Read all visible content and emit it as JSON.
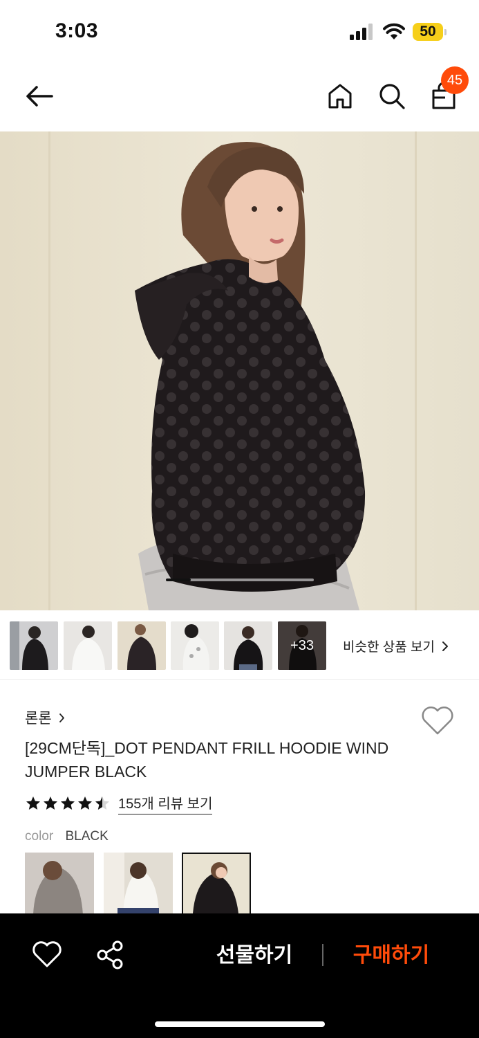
{
  "status_bar": {
    "time": "3:03",
    "battery": "50"
  },
  "header": {
    "back_icon": "arrow-left-icon",
    "home_icon": "home-icon",
    "search_icon": "search-icon",
    "cart_icon": "shopping-bag-icon",
    "cart_count": "45"
  },
  "gallery": {
    "thumbnail_count": 6,
    "more_count": "+33",
    "similar_link": "비슷한 상품 보기"
  },
  "product": {
    "brand": "론론",
    "title": "[29CM단독]_DOT PENDANT FRILL HOODIE WIND JUMPER BLACK",
    "rating": 4.5,
    "review_link": "155개 리뷰 보기",
    "option_label": "color",
    "option_value": "BLACK"
  },
  "bottom_bar": {
    "gift_label": "선물하기",
    "buy_label": "구매하기"
  },
  "colors": {
    "accent": "#ff4b0a",
    "battery": "#f6cf1a"
  }
}
